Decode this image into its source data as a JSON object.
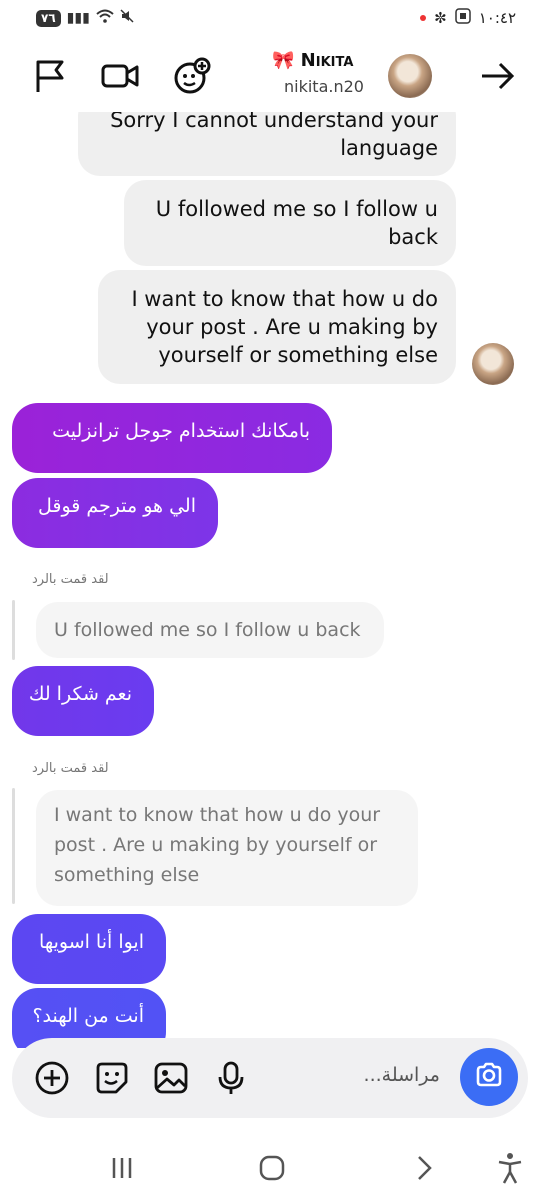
{
  "status_bar": {
    "battery": "٧٦",
    "time": "١٠:٤٢"
  },
  "header": {
    "contact_name": "🎀 Nikita",
    "username": "nikita.n20",
    "icons": [
      "flag-icon",
      "video-call-icon",
      "effects-icon",
      "forward-arrow-icon"
    ]
  },
  "messages": {
    "in": [
      "Sorry I cannot understand your language",
      "U followed me so I follow u back",
      "I want to know that how u do your post . Are u making by yourself or something else"
    ],
    "out": [
      "بامكانك استخدام جوجل ترانزليت",
      "الي هو مترجم قوقل",
      "نعم شكرا لك",
      "ايوا أنا اسويها",
      "أنت من الهند؟"
    ],
    "replies": [
      {
        "label": "لقد قمت بالرد",
        "quoted": "U followed me so I follow u back"
      },
      {
        "label": "لقد قمت بالرد",
        "quoted": "I want to know that how u do your post . Are u making by yourself or something else"
      }
    ]
  },
  "composer": {
    "placeholder": "مراسلة...",
    "icons": [
      "add-icon",
      "sticker-icon",
      "gallery-icon",
      "microphone-icon",
      "camera-icon"
    ]
  },
  "colors": {
    "accent_purple": "#8a2be2",
    "accent_blue": "#3b6df5",
    "incoming_bubble": "#efefef"
  }
}
